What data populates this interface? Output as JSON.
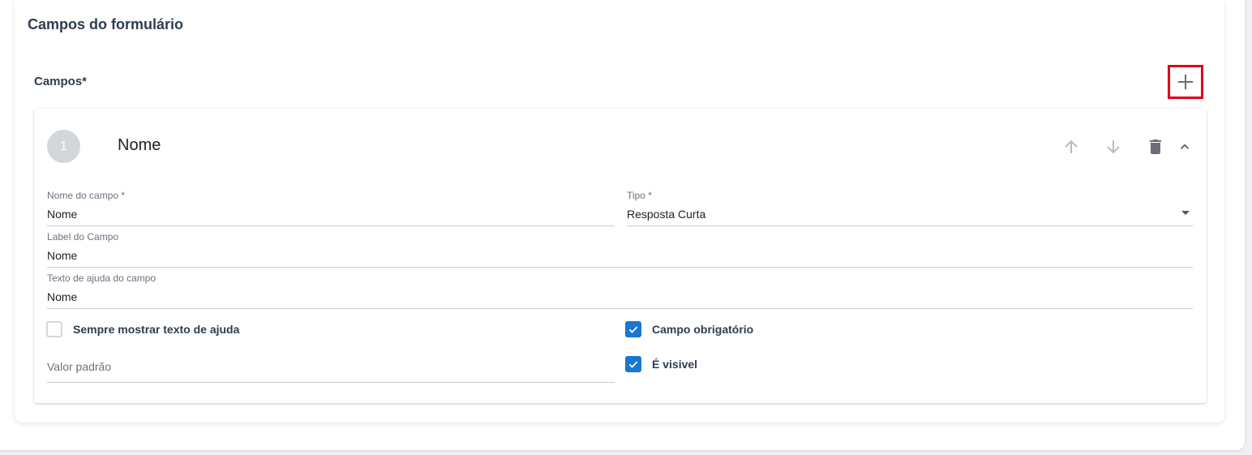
{
  "section": {
    "title": "Campos do formulário"
  },
  "fields_header": {
    "label": "Campos*"
  },
  "add_icon": "plus-icon",
  "field": {
    "index": "1",
    "title": "Nome",
    "nome_campo": {
      "label": "Nome do campo *",
      "value": "Nome"
    },
    "tipo": {
      "label": "Tipo *",
      "value": "Resposta Curta"
    },
    "label_campo": {
      "label": "Label do Campo",
      "value": "Nome"
    },
    "texto_ajuda": {
      "label": "Texto de ajuda do campo",
      "value": "Nome"
    },
    "sempre_mostrar": {
      "label": "Sempre mostrar texto de ajuda",
      "checked": false
    },
    "valor_padrao": {
      "placeholder": "Valor padrão",
      "value": ""
    },
    "obrigatorio": {
      "label": "Campo obrigatório",
      "checked": true
    },
    "visivel": {
      "label": "É visivel",
      "checked": true
    }
  },
  "colors": {
    "accent": "#1976d2",
    "highlight": "#e0001a",
    "heading": "#2f3d4f"
  }
}
